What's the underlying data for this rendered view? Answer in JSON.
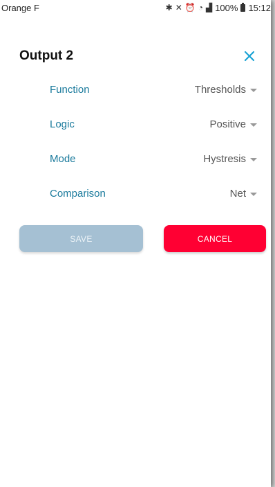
{
  "status_bar": {
    "carrier": "Orange F",
    "battery": "100%",
    "time": "15:12"
  },
  "dialog": {
    "title": "Output 2",
    "fields": [
      {
        "label": "Function",
        "value": "Thresholds"
      },
      {
        "label": "Logic",
        "value": "Positive"
      },
      {
        "label": "Mode",
        "value": "Hystresis"
      },
      {
        "label": "Comparison",
        "value": "Net"
      }
    ],
    "save_label": "SAVE",
    "cancel_label": "CANCEL"
  },
  "colors": {
    "accent": "#1a7a9c",
    "close_icon": "#1aa3d4",
    "save_disabled": "#a5c0d3",
    "cancel": "#ff0033"
  }
}
